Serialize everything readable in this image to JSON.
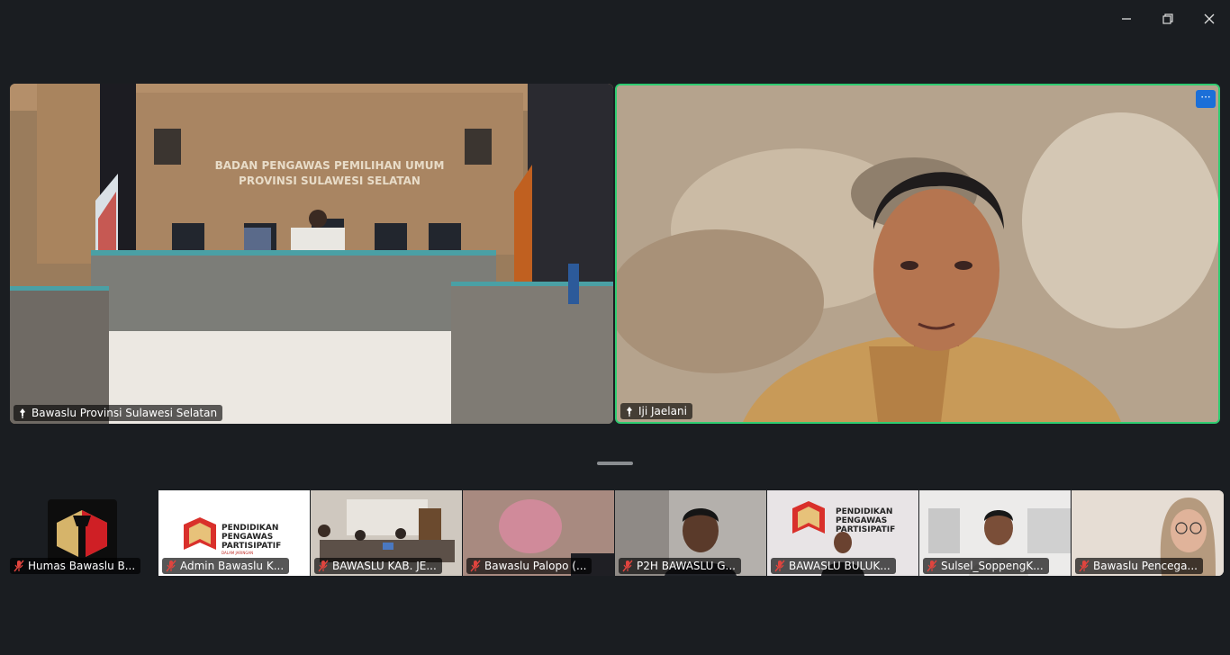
{
  "window_controls": {
    "minimize": "minimize",
    "restore": "restore",
    "close": "close"
  },
  "main_participants": [
    {
      "name": "Bawaslu Provinsi Sulawesi Selatan",
      "wall_text_1": "BADAN PENGAWAS PEMILIHAN UMUM",
      "wall_text_2": "PROVINSI SULAWESI SELATAN"
    },
    {
      "name": "Iji Jaelani",
      "more_label": "···"
    }
  ],
  "strip_participants": [
    {
      "name": "Humas Bawaslu B..."
    },
    {
      "name": "Admin Bawaslu K...",
      "logo_line1": "PENDIDIKAN",
      "logo_line2": "PENGAWAS",
      "logo_line3": "PARTISIPATIF",
      "logo_line4": "DALAM JARINGAN"
    },
    {
      "name": "BAWASLU KAB. JE..."
    },
    {
      "name": "Bawaslu Palopo (..."
    },
    {
      "name": "P2H BAWASLU G..."
    },
    {
      "name": "BAWASLU BULUK...",
      "logo_line1": "PENDIDIKAN",
      "logo_line2": "PENGAWAS",
      "logo_line3": "PARTISIPATIF"
    },
    {
      "name": "Sulsel_SoppengK..."
    },
    {
      "name": "Bawaslu Pencega..."
    }
  ],
  "colors": {
    "active_speaker_border": "#2ecc71",
    "background": "#1a1d21",
    "muted_icon": "#e0443e"
  }
}
